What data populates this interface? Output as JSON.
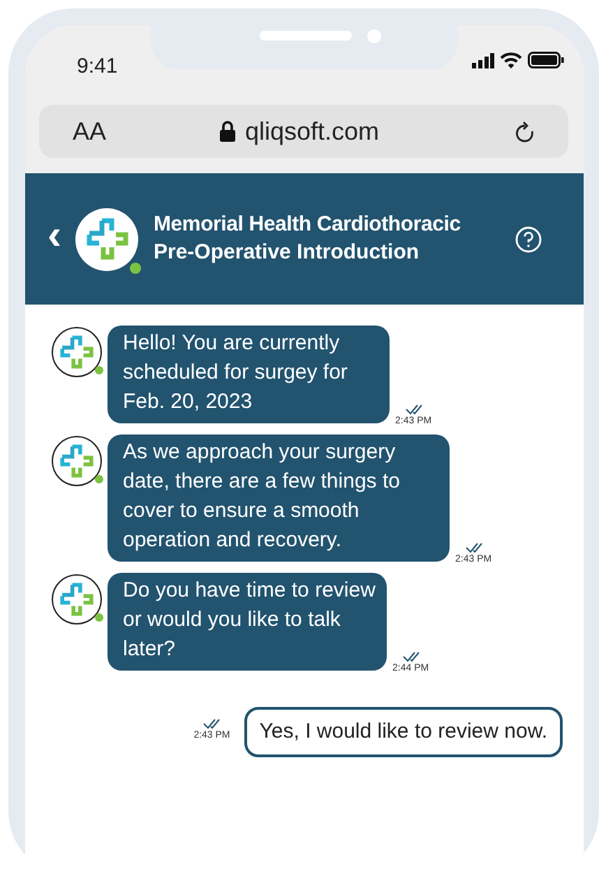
{
  "status_bar": {
    "time": "9:41"
  },
  "url_bar": {
    "text_size_label": "AA",
    "url": "qliqsoft.com"
  },
  "header": {
    "back": "‹",
    "title_line_1": "Memorial Health Cardiothoracic",
    "title_line_2": "Pre-Operative Introduction",
    "online": true
  },
  "messages": [
    {
      "kind": "bot",
      "text": "Hello! You are currently scheduled for surgey for Feb. 20, 2023",
      "time": "2:43 PM",
      "read": true
    },
    {
      "kind": "bot",
      "text": "As we approach your surgery date, there are a few things to cover to ensure a smooth operation and recovery.",
      "time": "2:43 PM",
      "read": true
    },
    {
      "kind": "bot",
      "text": "Do you have time to review or would you like to talk later?",
      "time": "2:44 PM",
      "read": true
    },
    {
      "kind": "user",
      "text": "Yes, I would like to review now.",
      "time": "2:43 PM",
      "read": true
    }
  ]
}
